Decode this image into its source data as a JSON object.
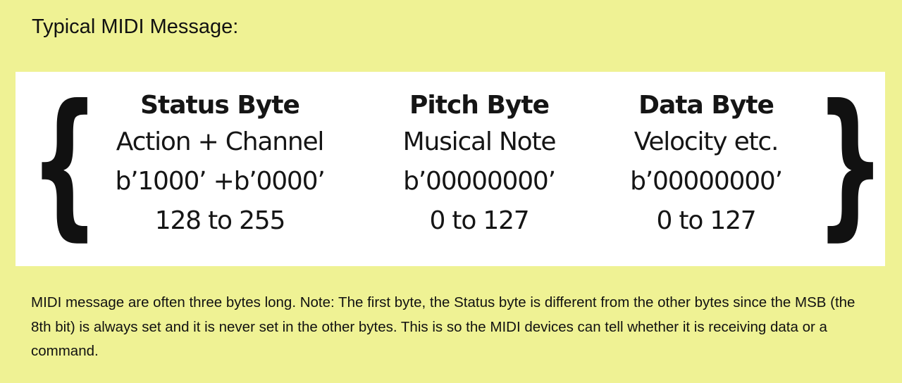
{
  "title": "Typical MIDI Message:",
  "diagram": {
    "left_brace": "{",
    "right_brace": "}",
    "columns": [
      {
        "title": "Status Byte",
        "description": "Action + Channel",
        "bits": "b’1000’ +b’0000’",
        "range": "128 to 255"
      },
      {
        "title": "Pitch Byte",
        "description": "Musical Note",
        "bits": "b’00000000’",
        "range": "0 to 127"
      },
      {
        "title": "Data Byte",
        "description": "Velocity etc.",
        "bits": "b’00000000’",
        "range": "0 to 127"
      }
    ]
  },
  "description": "MIDI message are often three bytes long. Note: The first byte, the Status byte is different from the other bytes since the MSB (the 8th bit) is always set and it is never set in the other bytes. This is so the MIDI devices can tell whether it is receiving data or a command.",
  "colors": {
    "background": "#eff294",
    "panel": "#ffffff",
    "text": "#111111"
  }
}
